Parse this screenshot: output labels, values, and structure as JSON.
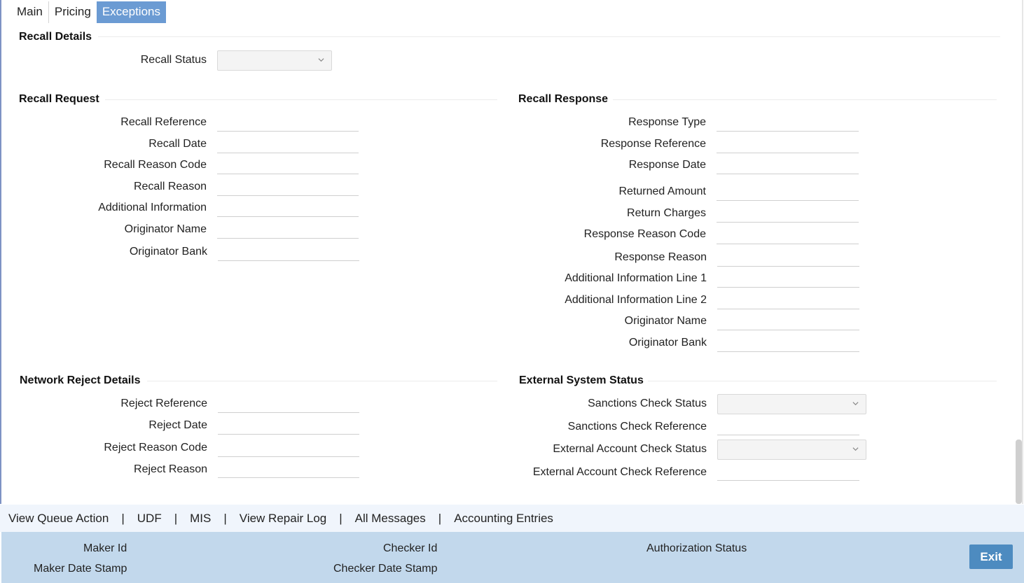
{
  "tabs": [
    {
      "label": "Main",
      "active": false
    },
    {
      "label": "Pricing",
      "active": false
    },
    {
      "label": "Exceptions",
      "active": true
    }
  ],
  "recall_details": {
    "title": "Recall Details",
    "recall_status_label": "Recall Status",
    "recall_status_value": ""
  },
  "recall_request": {
    "title": "Recall Request",
    "fields": [
      {
        "label": "Recall Reference",
        "value": ""
      },
      {
        "label": "Recall Date",
        "value": ""
      },
      {
        "label": "Recall Reason Code",
        "value": ""
      },
      {
        "label": "Recall Reason",
        "value": ""
      },
      {
        "label": "Additional Information",
        "value": ""
      },
      {
        "label": "Originator Name",
        "value": ""
      },
      {
        "label": "Originator Bank",
        "value": ""
      }
    ]
  },
  "recall_response": {
    "title": "Recall Response",
    "fields": [
      {
        "label": "Response Type",
        "value": ""
      },
      {
        "label": "Response Reference",
        "value": ""
      },
      {
        "label": "Response Date",
        "value": ""
      },
      {
        "label": "Returned Amount",
        "value": ""
      },
      {
        "label": "Return Charges",
        "value": ""
      },
      {
        "label": "Response Reason Code",
        "value": ""
      },
      {
        "label": "Response Reason",
        "value": ""
      },
      {
        "label": "Additional Information Line 1",
        "value": ""
      },
      {
        "label": "Additional Information Line 2",
        "value": ""
      },
      {
        "label": "Originator Name",
        "value": ""
      },
      {
        "label": "Originator Bank",
        "value": ""
      }
    ]
  },
  "network_reject": {
    "title": "Network Reject Details",
    "fields": [
      {
        "label": "Reject Reference",
        "value": ""
      },
      {
        "label": "Reject Date",
        "value": ""
      },
      {
        "label": "Reject Reason Code",
        "value": ""
      },
      {
        "label": "Reject Reason",
        "value": ""
      }
    ]
  },
  "external_system": {
    "title": "External System Status",
    "sanctions_check_status_label": "Sanctions Check Status",
    "sanctions_check_status_value": "",
    "sanctions_check_reference_label": "Sanctions Check Reference",
    "sanctions_check_reference_value": "",
    "external_account_check_status_label": "External Account Check Status",
    "external_account_check_status_value": "",
    "external_account_check_reference_label": "External Account Check Reference",
    "external_account_check_reference_value": ""
  },
  "links": [
    "View Queue Action",
    "UDF",
    "MIS",
    "View Repair Log",
    "All Messages",
    "Accounting Entries"
  ],
  "link_separator": "|",
  "footer": {
    "maker_id": "Maker Id",
    "maker_date_stamp": "Maker Date Stamp",
    "checker_id": "Checker Id",
    "checker_date_stamp": "Checker Date Stamp",
    "authorization_status": "Authorization Status",
    "exit": "Exit"
  },
  "icons": {
    "dropdown": "chevron-down-icon"
  },
  "colors": {
    "active_tab": "#6b9bd3",
    "footer_bg": "#c2d8ec",
    "linkbar_bg": "#f0f5fc",
    "exit_button": "#4d8bc0"
  }
}
